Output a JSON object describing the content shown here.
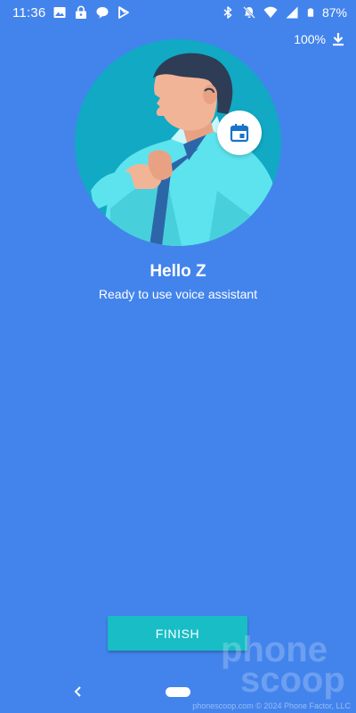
{
  "status_bar": {
    "time": "11:36",
    "battery_percent": "87%",
    "left_icons": [
      "image-icon",
      "lock-icon",
      "chat-bubble-icon",
      "play-store-icon"
    ],
    "right_icons": [
      "bluetooth-icon",
      "bell-off-icon",
      "wifi-icon",
      "cell-signal-icon",
      "battery-icon"
    ]
  },
  "download": {
    "percent": "100%",
    "icon": "download-icon"
  },
  "illustration": {
    "badge_icon": "calendar-icon",
    "colors": {
      "circle": "#11a9c3",
      "shirt": "#5de3ee",
      "skin": "#f2b497",
      "hair": "#2e3c55",
      "tie": "#2c66a8"
    }
  },
  "greeting": {
    "title": "Hello Z",
    "subtitle": "Ready to use voice assistant"
  },
  "finish_button": {
    "label": "FINISH"
  },
  "nav": {
    "back_icon": "back-chevron-icon",
    "home_icon": "home-pill-icon"
  },
  "watermark": {
    "logo_line1": "phone",
    "logo_line2": "scoop",
    "credit": "phonescoop.com © 2024 Phone Factor, LLC"
  },
  "colors": {
    "background": "#4384ec",
    "button": "#18bdc6"
  }
}
